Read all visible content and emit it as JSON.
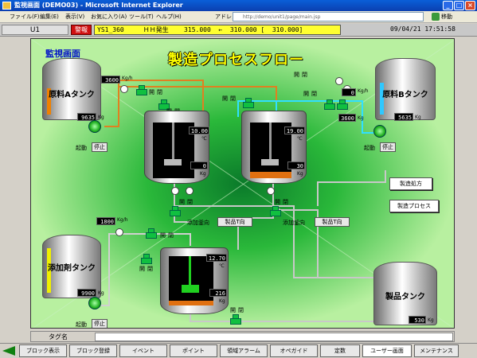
{
  "window": {
    "title": "監視画面 (DEMO03) - Microsoft Internet Explorer",
    "menu": [
      "ファイル(F)",
      "編集(E)",
      "表示(V)",
      "お気に入り(A)",
      "ツール(T)",
      "ヘルプ(H)"
    ],
    "address_label": "アドレス(D)",
    "address_value": "http://demo/unit1/page/main.jsp",
    "go_label": "移動",
    "controls": [
      "_",
      "□",
      "×"
    ]
  },
  "status": {
    "unit": "U1",
    "alarm_button": "警報",
    "alarm_message": "YS1_360     ＨＨ発生    315.000  ←  310.000 [  310.000]",
    "datetime": "09/04/21 17:51:58"
  },
  "main": {
    "screen_label": "監視画面",
    "title": "製造プロセスフロー",
    "tanks": {
      "a": {
        "label": "原料Aタンク",
        "value": "9635",
        "unit": "Kg",
        "level_color": "#f08000",
        "level_pct": 0.5
      },
      "b": {
        "label": "原料Bタンク",
        "value": "5635",
        "unit": "Kg",
        "level_color": "#30c8ff",
        "level_pct": 0.6
      },
      "additive": {
        "label": "添加剤タンク",
        "value": "9900",
        "unit": "Kg",
        "level_color": "#f0f000",
        "level_pct": 0.85
      },
      "product": {
        "label": "製品タンク",
        "value": "530",
        "unit": "Kg"
      }
    },
    "flows": {
      "a": {
        "value": "3600",
        "unit": "Kg/h"
      },
      "b": {
        "value": "0",
        "unit": "Kg/h"
      },
      "b2": {
        "value": "3600",
        "unit": "Kg"
      },
      "additive": {
        "value": "1800",
        "unit": "Kg/h"
      }
    },
    "reactors": {
      "r1": {
        "temp": "10.00",
        "temp_unit": "℃",
        "weight": "0",
        "weight_unit": "Kg"
      },
      "r2": {
        "temp": "19.00",
        "temp_unit": "℃",
        "weight": "30",
        "weight_unit": "Kg"
      },
      "r3": {
        "temp": "12.70",
        "temp_unit": "℃",
        "weight": "216",
        "weight_unit": "Kg"
      }
    },
    "labels": {
      "open": "開",
      "close": "閉",
      "start": "起動",
      "stop": "停止",
      "add_direction": "添加釜向",
      "product_t_direction": "製品T向"
    },
    "buttons": {
      "recipe": "製造処方",
      "process": "製造プロセス"
    }
  },
  "tag": {
    "label": "タグ名",
    "value": ""
  },
  "function_keys": [
    "ブロック表示",
    "ブロック登録",
    "イベント",
    "ポイント",
    "領域アラーム",
    "オペガイド",
    "定数",
    "ユーザー画面",
    "メンテナンス"
  ]
}
